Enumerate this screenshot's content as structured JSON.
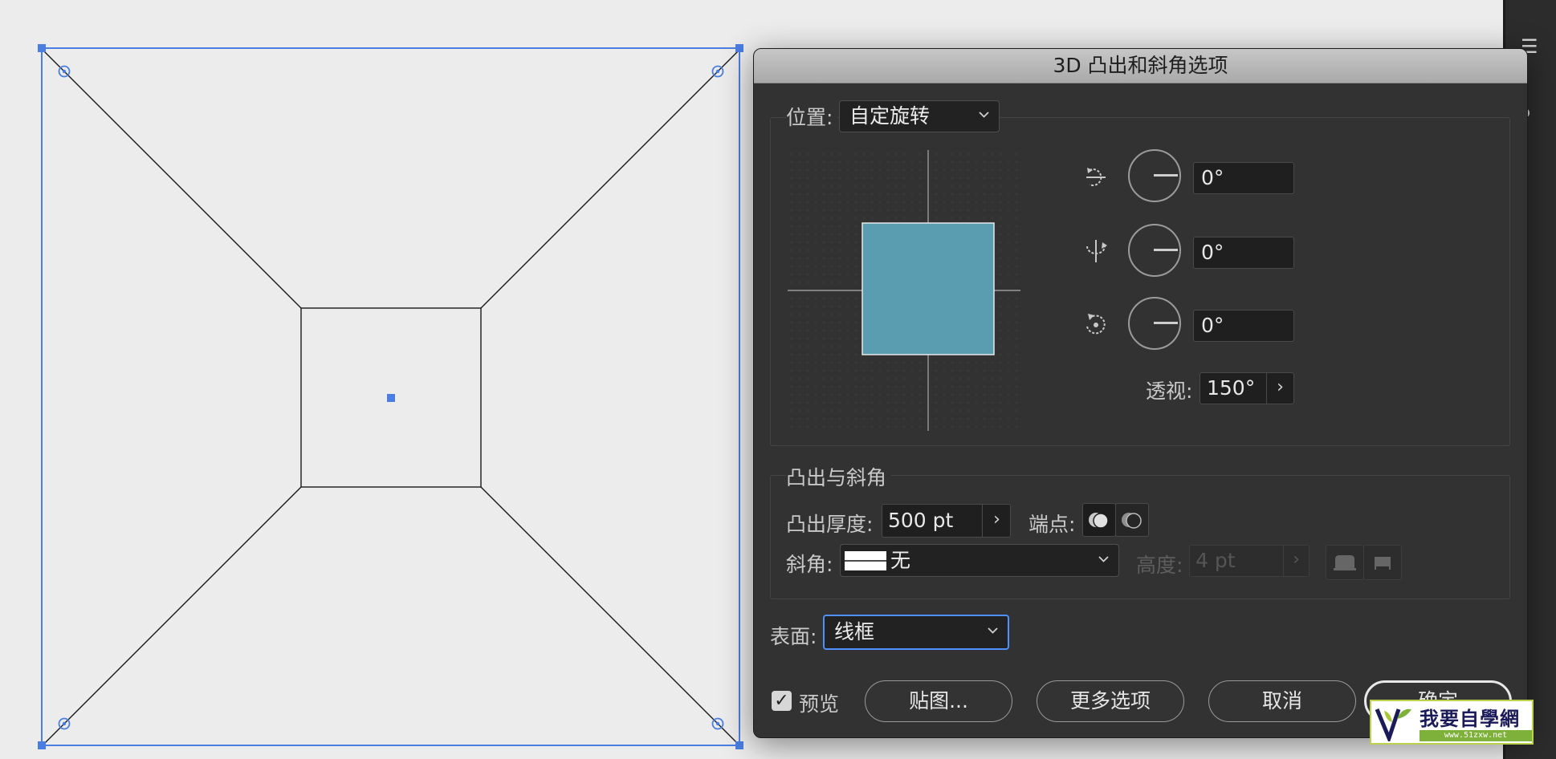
{
  "dialog": {
    "title": "3D 凸出和斜角选项",
    "position": {
      "label": "位置:",
      "selected": "自定旋转",
      "rotation_x": "0°",
      "rotation_y": "0°",
      "rotation_z": "0°",
      "perspective_label": "透视:",
      "perspective_value": "150°",
      "perspective_stepper": "›",
      "cube_color": "#5b9db0"
    },
    "extrude": {
      "section_label": "凸出与斜角",
      "depth_label": "凸出厚度:",
      "depth_value": "500 pt",
      "depth_stepper": "›",
      "cap_label": "端点:",
      "bevel_label": "斜角:",
      "bevel_value": "无",
      "height_label": "高度:",
      "height_value": "4 pt",
      "height_stepper": "›"
    },
    "surface": {
      "label": "表面:",
      "selected": "线框",
      "highlight_color": "#4d90fe"
    },
    "footer": {
      "preview_label": "预览",
      "preview_checked": "✓",
      "map_button": "贴图...",
      "more_button": "更多选项",
      "cancel_button": "取消",
      "ok_button": "确定"
    }
  },
  "canvas": {
    "background": "#eeeeee",
    "selection_color": "#4a7ee0",
    "wire_color": "#1a1a1a"
  },
  "side_panel": {
    "glyph_top": "☰",
    "glyph_mid": "●"
  },
  "watermark": {
    "text": "我要自學網",
    "url": "www.51zxw.net"
  }
}
